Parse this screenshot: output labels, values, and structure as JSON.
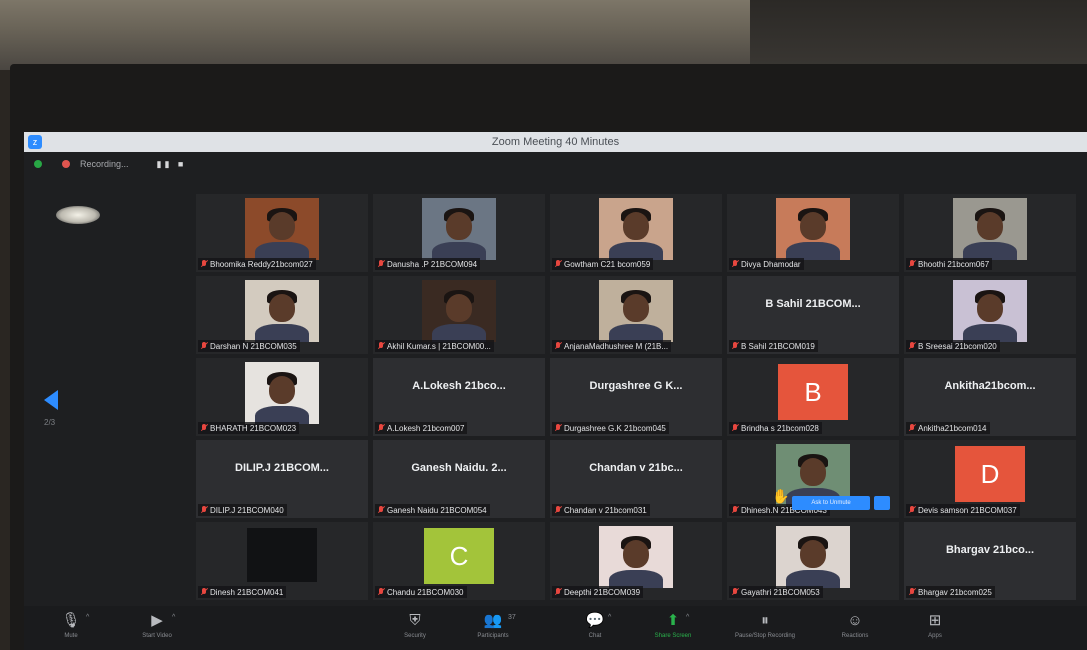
{
  "window": {
    "title": "Zoom Meeting 40 Minutes",
    "app_icon": "zoom-icon"
  },
  "recording": {
    "label": "Recording...",
    "controls": "▮▮ ■"
  },
  "pager": {
    "indicator": "2/3"
  },
  "participants": [
    {
      "name": "Bhoomika Reddy21bcom027",
      "display": "photo",
      "bg": "#8c4a2a"
    },
    {
      "name": "Danusha .P 21BCOM094",
      "display": "photo",
      "bg": "#6b7684"
    },
    {
      "name": "Gowtham C21 bcom059",
      "display": "photo",
      "bg": "#c9a48c"
    },
    {
      "name": "Divya Dhamodar",
      "display": "photo",
      "bg": "#c77b5a"
    },
    {
      "name": "Bhoothi 21bcom067",
      "display": "photo",
      "bg": "#9a9890"
    },
    {
      "name": "Darshan N 21BCOM035",
      "display": "photo",
      "bg": "#d3cbbf"
    },
    {
      "name": "Akhil Kumar.s | 21BCOM00...",
      "display": "photo",
      "bg": "#3a2a22"
    },
    {
      "name": "AnjanaMadhushree M (21B...",
      "display": "photo",
      "bg": "#bfb09c"
    },
    {
      "name": "B Sahil 21BCOM019",
      "display": "text",
      "center": "B Sahil 21BCOM..."
    },
    {
      "name": "B Sreesai 21bcom020",
      "display": "photo",
      "bg": "#c9c1d4"
    },
    {
      "name": "BHARATH 21BCOM023",
      "display": "photo",
      "bg": "#e6e3df"
    },
    {
      "name": "A.Lokesh 21bcom007",
      "display": "text",
      "center": "A.Lokesh 21bco..."
    },
    {
      "name": "Durgashree G.K 21bcom045",
      "display": "text",
      "center": "Durgashree G K..."
    },
    {
      "name": "Brindha s 21bcom028",
      "display": "letter",
      "letter": "B",
      "bg": "#e5553c"
    },
    {
      "name": "Ankitha21bcom014",
      "display": "text",
      "center": "Ankitha21bcom..."
    },
    {
      "name": "DILIP.J 21BCOM040",
      "display": "text",
      "center": "DILIP.J 21BCOM..."
    },
    {
      "name": "Ganesh Naidu 21BCOM054",
      "display": "text",
      "center": "Ganesh Naidu. 2..."
    },
    {
      "name": "Chandan v 21bcom031",
      "display": "text",
      "center": "Chandan v 21bc..."
    },
    {
      "name": "Dhinesh.N 21BCOM043",
      "display": "photo",
      "bg": "#6f8e74"
    },
    {
      "name": "Devis samson 21BCOM037",
      "display": "letter",
      "letter": "D",
      "bg": "#e5553c"
    },
    {
      "name": "Dinesh 21BCOM041",
      "display": "black"
    },
    {
      "name": "Chandu 21BCOM030",
      "display": "letter",
      "letter": "C",
      "bg": "#a3c43a"
    },
    {
      "name": "Deepthi 21BCOM039",
      "display": "photo",
      "bg": "#e8dad8"
    },
    {
      "name": "Gayathri 21BCOM053",
      "display": "photo",
      "bg": "#dcd4cf"
    },
    {
      "name": "Bhargav 21bcom025",
      "display": "text",
      "center": "Bhargav 21bco..."
    }
  ],
  "raised_hand": {
    "icon": "raised-hand-icon",
    "tooltip": "Ask to Unmute"
  },
  "toolbar": {
    "items": [
      {
        "label": "Mute",
        "icon": "microphone-icon",
        "glyph": "🎙"
      },
      {
        "label": "Start Video",
        "icon": "video-camera-icon",
        "glyph": "▶"
      },
      {
        "label": "Security",
        "icon": "shield-icon",
        "glyph": "⛨"
      },
      {
        "label": "Participants",
        "icon": "participants-icon",
        "glyph": "👥"
      },
      {
        "label": "Chat",
        "icon": "chat-icon",
        "glyph": "💬"
      },
      {
        "label": "Share Screen",
        "icon": "share-screen-icon",
        "glyph": "⬆"
      },
      {
        "label": "Pause/Stop Recording",
        "icon": "pause-stop-icon",
        "glyph": "⏸"
      },
      {
        "label": "Reactions",
        "icon": "reactions-icon",
        "glyph": "☺"
      },
      {
        "label": "Apps",
        "icon": "apps-icon",
        "glyph": "⊞"
      }
    ],
    "participant_count": "37"
  },
  "colors": {
    "accent": "#2d8cff",
    "muted_mic": "#e8473f",
    "share": "#2ab24c"
  }
}
